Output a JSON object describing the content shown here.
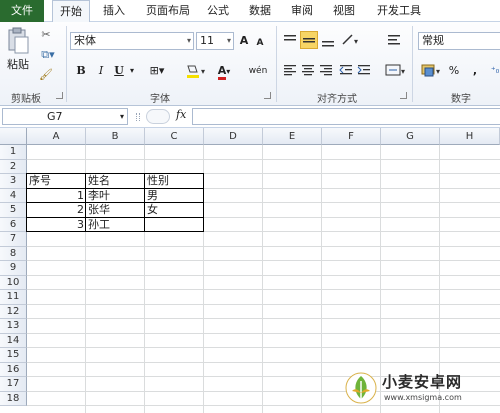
{
  "tabs": [
    "文件",
    "开始",
    "插入",
    "页面布局",
    "公式",
    "数据",
    "审阅",
    "视图",
    "开发工具"
  ],
  "ribbon": {
    "clipboard": {
      "paste_label": "粘贴",
      "group_label": "剪贴板"
    },
    "font": {
      "font_name": "宋体",
      "font_size": "11",
      "bold": "B",
      "italic": "I",
      "underline": "U",
      "group_label": "字体",
      "grow": "A",
      "shrink": "A",
      "font_color": "A",
      "phonetic": "wén"
    },
    "alignment": {
      "group_label": "对齐方式"
    },
    "number": {
      "format": "常规",
      "percent": "%",
      "comma": ",",
      "group_label": "数字"
    }
  },
  "formula_bar": {
    "name_box": "G7",
    "fx": "fx",
    "formula": ""
  },
  "columns": [
    "A",
    "B",
    "C",
    "D",
    "E",
    "F",
    "G",
    "H"
  ],
  "rows": [
    "1",
    "2",
    "3",
    "4",
    "5",
    "6",
    "7",
    "8",
    "9",
    "10",
    "11",
    "12",
    "13",
    "14",
    "15",
    "16",
    "17",
    "18"
  ],
  "cells": {
    "A3": "序号",
    "B3": "姓名",
    "C3": "性别",
    "A4": "1",
    "B4": "李叶",
    "C4": "男",
    "A5": "2",
    "B5": "张华",
    "C5": "女",
    "A6": "3",
    "B6": "孙工",
    "C6": ""
  },
  "watermark": {
    "title": "小麦安卓网",
    "url": "www.xmsigma.com"
  }
}
